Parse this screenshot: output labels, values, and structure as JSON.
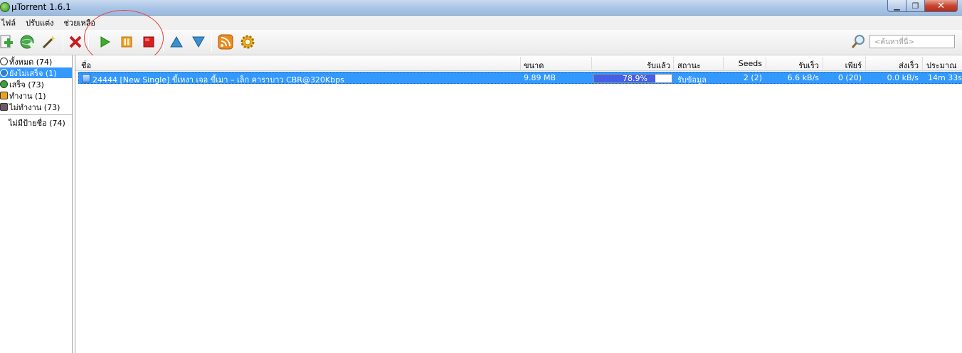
{
  "window": {
    "title": "µTorrent 1.6.1"
  },
  "menu": {
    "items": [
      "ไฟล์",
      "ปรับแต่ง",
      "ช่วยเหลือ"
    ]
  },
  "search": {
    "placeholder": "<ค้นหาที่นี่>"
  },
  "sidebar": {
    "items": [
      {
        "label": "ทั้งหมด (74)",
        "icon": "all-icon"
      },
      {
        "label": "ยังไม่เสร็จ (1)",
        "icon": "downloading-icon",
        "selected": true
      },
      {
        "label": "เสร็จ (73)",
        "icon": "completed-icon"
      },
      {
        "label": "ทำงาน (1)",
        "icon": "active-icon"
      },
      {
        "label": "ไม่ทำงาน (73)",
        "icon": "inactive-icon"
      }
    ],
    "label_item": "ไม่มีป้ายชื่อ (74)"
  },
  "table": {
    "headers": {
      "name": "ชื่อ",
      "size": "ขนาด",
      "done": "รับแล้ว",
      "status": "สถานะ",
      "seeds": "Seeds",
      "down_speed": "รับเร็ว",
      "peers": "เพียร์",
      "up_speed": "ส่งเร็ว",
      "eta": "ประมาณ"
    },
    "rows": [
      {
        "name": "24444 [New Single] ขี้เหงา เจอ ขี้เมา – เล็ก คาราบาว CBR@320Kbps",
        "size": "9.89 MB",
        "done": "78.9%",
        "progress_fraction": 0.789,
        "status": "รับข้อมูล",
        "seeds": "2 (2)",
        "down_speed": "6.6 kB/s",
        "peers": "0 (20)",
        "up_speed": "0.0 kB/s",
        "eta": "14m 33s"
      }
    ]
  },
  "colors": {
    "selection": "#3399ff",
    "progress": "#4460e8",
    "annotation_circle": "#d44444"
  }
}
